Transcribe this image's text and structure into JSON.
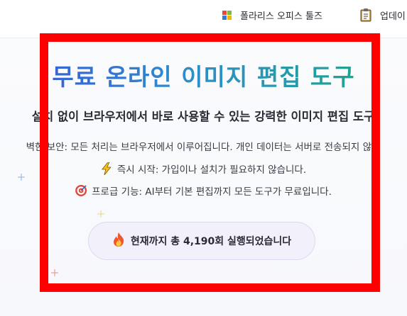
{
  "topbar": {
    "office_tools_label": "폴라리스 오피스 툴즈",
    "update_label": "업데이"
  },
  "hero": {
    "title": "무료 온라인 이미지 편집 도구",
    "subtitle": "설치 없이 브라우저에서 바로 사용할 수 있는 강력한 이미지 편집 도구"
  },
  "features": [
    {
      "icon": "lock-icon",
      "text": "벽한 보안: 모든 처리는 브라우저에서 이루어집니다. 개인 데이터는 서버로 전송되지 않습"
    },
    {
      "icon": "lightning-icon",
      "text": "즉시 시작: 가입이나 설치가 필요하지 않습니다."
    },
    {
      "icon": "target-icon",
      "text": "프로급 기능: AI부터 기본 편집까지 모든 도구가 무료입니다."
    }
  ],
  "counter": {
    "icon": "fire-icon",
    "text": "현재까지 총 4,190회 실행되었습니다"
  },
  "colors": {
    "highlight_frame": "#ff0000",
    "title_gradient_start": "#3a55d6",
    "title_gradient_end": "#1ea882",
    "pill_background": "#f2f1fb"
  }
}
